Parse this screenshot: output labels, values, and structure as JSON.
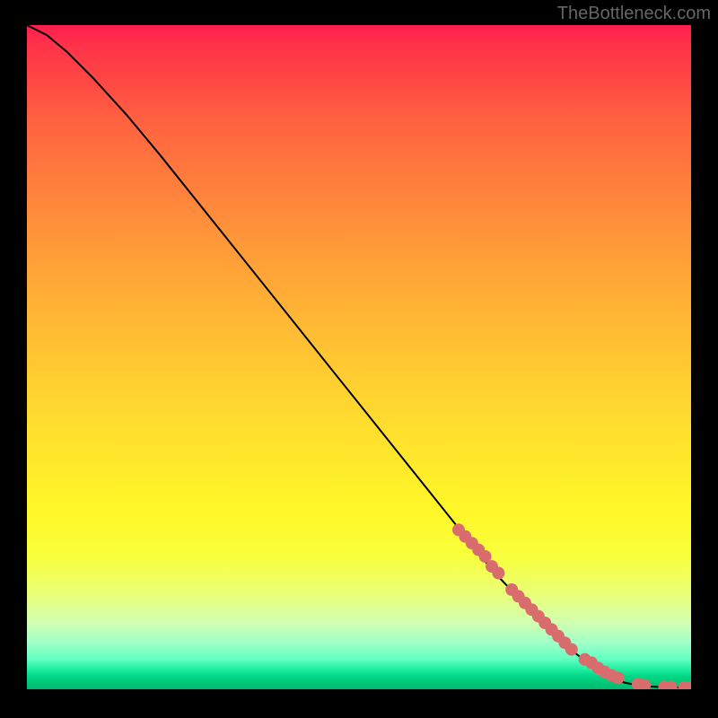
{
  "watermark": "TheBottleneck.com",
  "colors": {
    "curve": "#000000",
    "marker": "#d96d6d",
    "background": "#000000"
  },
  "chart_data": {
    "type": "line",
    "title": "",
    "xlabel": "",
    "ylabel": "",
    "xlim": [
      0,
      100
    ],
    "ylim": [
      0,
      100
    ],
    "curve": {
      "x": [
        0,
        3,
        6,
        10,
        15,
        20,
        30,
        40,
        50,
        60,
        70,
        80,
        85,
        88,
        90,
        92,
        94,
        96,
        98,
        100
      ],
      "y": [
        100,
        98.5,
        96,
        92,
        86.5,
        80.5,
        68,
        55.5,
        43,
        30.5,
        18,
        7.5,
        3.5,
        1.8,
        1.0,
        0.6,
        0.4,
        0.3,
        0.28,
        0.28
      ]
    },
    "markers": {
      "x": [
        65,
        66,
        67,
        68,
        69,
        70,
        71,
        73,
        74,
        75,
        76,
        77,
        78,
        79,
        80,
        81,
        82,
        84,
        85,
        86,
        87,
        88,
        89,
        92,
        93,
        96,
        97,
        99,
        100
      ],
      "y": [
        24,
        23,
        22,
        21,
        20,
        18.5,
        17.5,
        15,
        14,
        13,
        12,
        11,
        10,
        9,
        8,
        7,
        6,
        4.5,
        4,
        3.2,
        2.6,
        2.1,
        1.7,
        0.8,
        0.6,
        0.35,
        0.32,
        0.28,
        0.28
      ]
    }
  }
}
